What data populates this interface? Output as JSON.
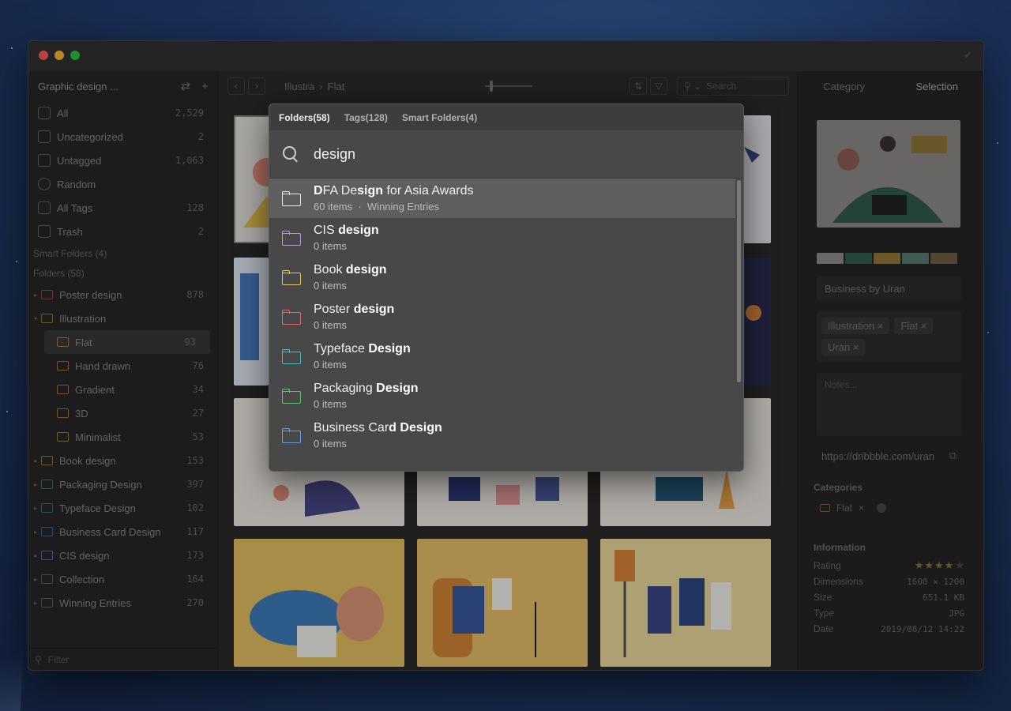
{
  "sidebar": {
    "library_name": "Graphic design ...",
    "nav": [
      {
        "label": "All",
        "count": "2,529"
      },
      {
        "label": "Uncategorized",
        "count": "2"
      },
      {
        "label": "Untagged",
        "count": "1,063"
      },
      {
        "label": "Random",
        "count": ""
      },
      {
        "label": "All Tags",
        "count": "128"
      },
      {
        "label": "Trash",
        "count": "2"
      }
    ],
    "smart_folders_label": "Smart Folders (4)",
    "folders_label": "Folders (58)",
    "folders": [
      {
        "label": "Poster design",
        "count": "878",
        "color": "#c95b5b"
      },
      {
        "label": "Illustration",
        "count": "",
        "color": "#c9a24a"
      },
      {
        "label": "Flat",
        "count": "93",
        "color": "#c9a24a"
      },
      {
        "label": "Hand drawn",
        "count": "76",
        "color": "#c9a24a"
      },
      {
        "label": "Gradient",
        "count": "34",
        "color": "#c9a24a"
      },
      {
        "label": "3D",
        "count": "27",
        "color": "#c9a24a"
      },
      {
        "label": "Minimalist",
        "count": "53",
        "color": "#c9a24a"
      },
      {
        "label": "Book design",
        "count": "153",
        "color": "#c9a24a"
      },
      {
        "label": "Packaging Design",
        "count": "397",
        "color": "#4f9e5c"
      },
      {
        "label": "Typeface Design",
        "count": "102",
        "color": "#3d97a3"
      },
      {
        "label": "Business Card Design",
        "count": "117",
        "color": "#4f7fbf"
      },
      {
        "label": "CIS design",
        "count": "173",
        "color": "#9a7fbf"
      },
      {
        "label": "Collection",
        "count": "164",
        "color": "#7a7a7a"
      },
      {
        "label": "Winning Entries",
        "count": "270",
        "color": "#7a7a7a"
      }
    ],
    "filter_placeholder": "Filter"
  },
  "toolbar": {
    "breadcrumb_parent": "Illustra",
    "breadcrumb_current": "Flat",
    "search_placeholder": "Search"
  },
  "right_panel": {
    "tab_category": "Category",
    "tab_selection": "Selection",
    "swatches": [
      "#d9d9d9",
      "#3a8a6a",
      "#e3b34a",
      "#7fb8a8",
      "#a58a5a"
    ],
    "title": "Business by Uran",
    "tags": [
      "Illustration",
      "Flat",
      "Uran"
    ],
    "notes_placeholder": "Notes...",
    "url": "https://dribbble.com/uran",
    "categories_label": "Categories",
    "category_item": "Flat",
    "information_label": "Information",
    "info": {
      "rating_label": "Rating",
      "rating_stars": "★★★★",
      "rating_empty": "★",
      "dimensions_label": "Dimensions",
      "dimensions": "1600 × 1200",
      "size_label": "Size",
      "size": "651.1 KB",
      "type_label": "Type",
      "type": "JPG",
      "date_label": "Date",
      "date": "2019/08/12 14:22"
    }
  },
  "popup": {
    "tabs": [
      "Folders(58)",
      "Tags(128)",
      "Smart Folders(4)"
    ],
    "query": "design",
    "results": [
      {
        "pre": "D",
        "hl": "",
        "mid": "FA De",
        "hl2": "sign",
        "post": " for Asia Awards",
        "sub": "60 items  ·  Winning Entries",
        "color": "#e8e8e8"
      },
      {
        "pre": "CIS ",
        "hl": "design",
        "mid": "",
        "hl2": "",
        "post": "",
        "sub": "0 items",
        "color": "#b59ad9"
      },
      {
        "pre": "Book ",
        "hl": "design",
        "mid": "",
        "hl2": "",
        "post": "",
        "sub": "0 items",
        "color": "#e3c35a"
      },
      {
        "pre": "Poster ",
        "hl": "design",
        "mid": "",
        "hl2": "",
        "post": "",
        "sub": "0 items",
        "color": "#e06b6b"
      },
      {
        "pre": "Typeface ",
        "hl": "Design",
        "mid": "",
        "hl2": "",
        "post": "",
        "sub": "0 items",
        "color": "#4fb5c3"
      },
      {
        "pre": "Packaging ",
        "hl": "Design",
        "mid": "",
        "hl2": "",
        "post": "",
        "sub": "0 items",
        "color": "#5fbf6c"
      },
      {
        "pre": "Business Car",
        "hl": "d",
        "mid": " ",
        "hl2": "Design",
        "post": "",
        "sub": "0 items",
        "color": "#6b9ee0"
      }
    ]
  }
}
